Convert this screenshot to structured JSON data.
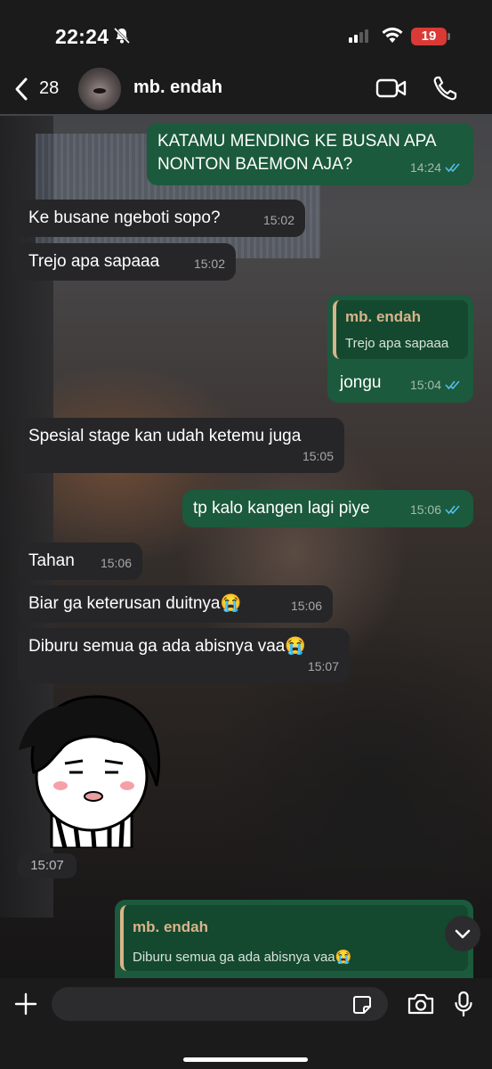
{
  "status_bar": {
    "time": "22:24",
    "battery": "19"
  },
  "header": {
    "back_count": "28",
    "contact_name": "mb. endah"
  },
  "messages": [
    {
      "side": "out",
      "lines": [
        "KATAMU MENDING KE BUSAN APA",
        "NONTON BAEMON AJA?"
      ],
      "time": "14:24",
      "read": true
    },
    {
      "side": "in",
      "text": "Ke busane ngeboti sopo?",
      "time": "15:02"
    },
    {
      "side": "in",
      "text": "Trejo apa sapaaa",
      "time": "15:02"
    },
    {
      "side": "out",
      "reply_to": {
        "name": "mb. endah",
        "text": "Trejo apa sapaaa"
      },
      "text": "jongu",
      "time": "15:04",
      "read": true
    },
    {
      "side": "in",
      "text": "Spesial stage kan udah ketemu juga",
      "time": "15:05"
    },
    {
      "side": "out",
      "text": "tp kalo kangen lagi piye",
      "time": "15:06",
      "read": true
    },
    {
      "side": "in",
      "text": "Tahan",
      "time": "15:06"
    },
    {
      "side": "in",
      "text": "Biar ga keterusan duitnya😭",
      "time": "15:06"
    },
    {
      "side": "in",
      "text": "Diburu semua ga ada abisnya vaa😭",
      "time": "15:07"
    },
    {
      "side": "in",
      "type": "sticker",
      "time": "15:07"
    }
  ],
  "reply_preview": {
    "name": "mb. endah",
    "text": "Diburu semua ga ada abisnya vaa😭"
  },
  "input": {
    "placeholder": ""
  },
  "colors": {
    "incoming": "#262628",
    "outgoing": "#1b5a3c",
    "reply_accent": "#d9b48a",
    "read_ticks": "#53bdeb"
  }
}
